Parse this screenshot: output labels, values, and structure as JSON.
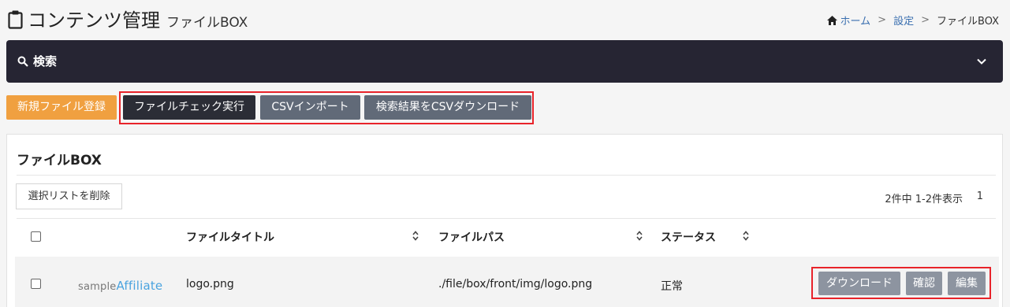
{
  "header": {
    "title": "コンテンツ管理",
    "subtitle": "ファイルBOX"
  },
  "breadcrumb": {
    "home": "ホーム",
    "settings": "設定",
    "current": "ファイルBOX",
    "separator": ">"
  },
  "search": {
    "label": "検索"
  },
  "toolbar": {
    "new_file": "新規ファイル登録",
    "file_check": "ファイルチェック実行",
    "csv_import": "CSVインポート",
    "csv_download": "検索結果をCSVダウンロード"
  },
  "panel": {
    "title": "ファイルBOX",
    "delete_selected": "選択リストを削除",
    "count": "2件中 1-2件表示",
    "page": "1"
  },
  "table": {
    "columns": [
      "ファイルタイトル",
      "ファイルパス",
      "ステータス"
    ],
    "rows": [
      {
        "logo_part1": "sample",
        "logo_part2": "Affiliate",
        "title": "logo.png",
        "path": "./file/box/front/img/logo.png",
        "status": "正常",
        "actions": [
          "ダウンロード",
          "確認",
          "編集"
        ]
      }
    ]
  },
  "colors": {
    "accent_orange": "#f0a040",
    "dark_bar": "#262533",
    "highlight_red": "#e8232a",
    "button_gray": "#616a78"
  }
}
